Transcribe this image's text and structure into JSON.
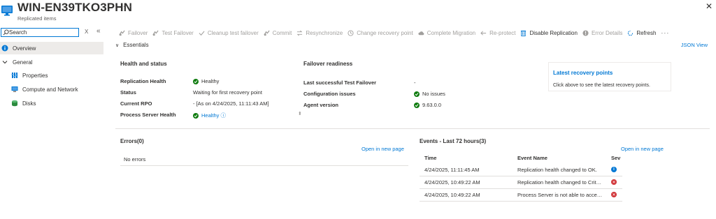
{
  "header": {
    "title": "WIN-EN39TKO3PHN",
    "subtitle": "Replicated items",
    "more": "···",
    "close": "✕"
  },
  "nav": {
    "search_placeholder": "Search",
    "clear": "X",
    "collapse": "«",
    "items": [
      {
        "label": "Overview",
        "icon": "info-icon"
      },
      {
        "label": "General",
        "icon": "chevron-down-icon"
      },
      {
        "label": "Properties",
        "icon": "properties-icon"
      },
      {
        "label": "Compute and Network",
        "icon": "monitor-icon"
      },
      {
        "label": "Disks",
        "icon": "disk-icon"
      }
    ]
  },
  "toolbar": {
    "items": [
      {
        "label": "Failover",
        "enabled": false
      },
      {
        "label": "Test Failover",
        "enabled": false
      },
      {
        "label": "Cleanup test failover",
        "enabled": false
      },
      {
        "label": "Commit",
        "enabled": false
      },
      {
        "label": "Resynchronize",
        "enabled": false
      },
      {
        "label": "Change recovery point",
        "enabled": false
      },
      {
        "label": "Complete Migration",
        "enabled": false
      },
      {
        "label": "Re-protect",
        "enabled": false
      },
      {
        "label": "Disable Replication",
        "enabled": true
      },
      {
        "label": "Error Details",
        "enabled": false
      },
      {
        "label": "Refresh",
        "enabled": true
      }
    ],
    "more": "···"
  },
  "essentials": {
    "label": "Essentials",
    "json_view": "JSON View",
    "health": {
      "heading": "Health and status",
      "replication_health_label": "Replication Health",
      "replication_health_value": "Healthy",
      "status_label": "Status",
      "status_value": "Waiting for first recovery point",
      "rpo_label": "Current RPO",
      "rpo_value": "- [As on 4/24/2025, 11:11:43 AM]",
      "ps_health_label": "Process Server Health",
      "ps_health_value": "Healthy ⓘ"
    },
    "failover": {
      "heading": "Failover readiness",
      "last_test_label": "Last successful Test Failover",
      "last_test_value": "-",
      "config_label": "Configuration issues",
      "config_value": "No issues",
      "agent_label": "Agent version",
      "agent_value": "9.63.0.0"
    },
    "recovery_points": {
      "title": "Latest recovery points",
      "description": "Click above to see the latest recovery points."
    }
  },
  "errors": {
    "title": "Errors(0)",
    "open_link": "Open in new page",
    "empty": "No errors"
  },
  "events": {
    "title": "Events - Last 72 hours(3)",
    "open_link": "Open in new page",
    "columns": [
      "Time",
      "Event Name",
      "Sev"
    ],
    "rows": [
      {
        "time": "4/24/2025, 11:11:45 AM",
        "name": "Replication health changed to OK.",
        "severity": "info"
      },
      {
        "time": "4/24/2025, 10:49:22 AM",
        "name": "Replication health changed to Crit…",
        "severity": "error"
      },
      {
        "time": "4/24/2025, 10:49:22 AM",
        "name": "Process Server is not able to acce…",
        "severity": "error"
      }
    ]
  },
  "colors": {
    "accent": "#0078d4",
    "success": "#107c10",
    "error": "#d13438",
    "selected_bg": "#edebe9"
  }
}
